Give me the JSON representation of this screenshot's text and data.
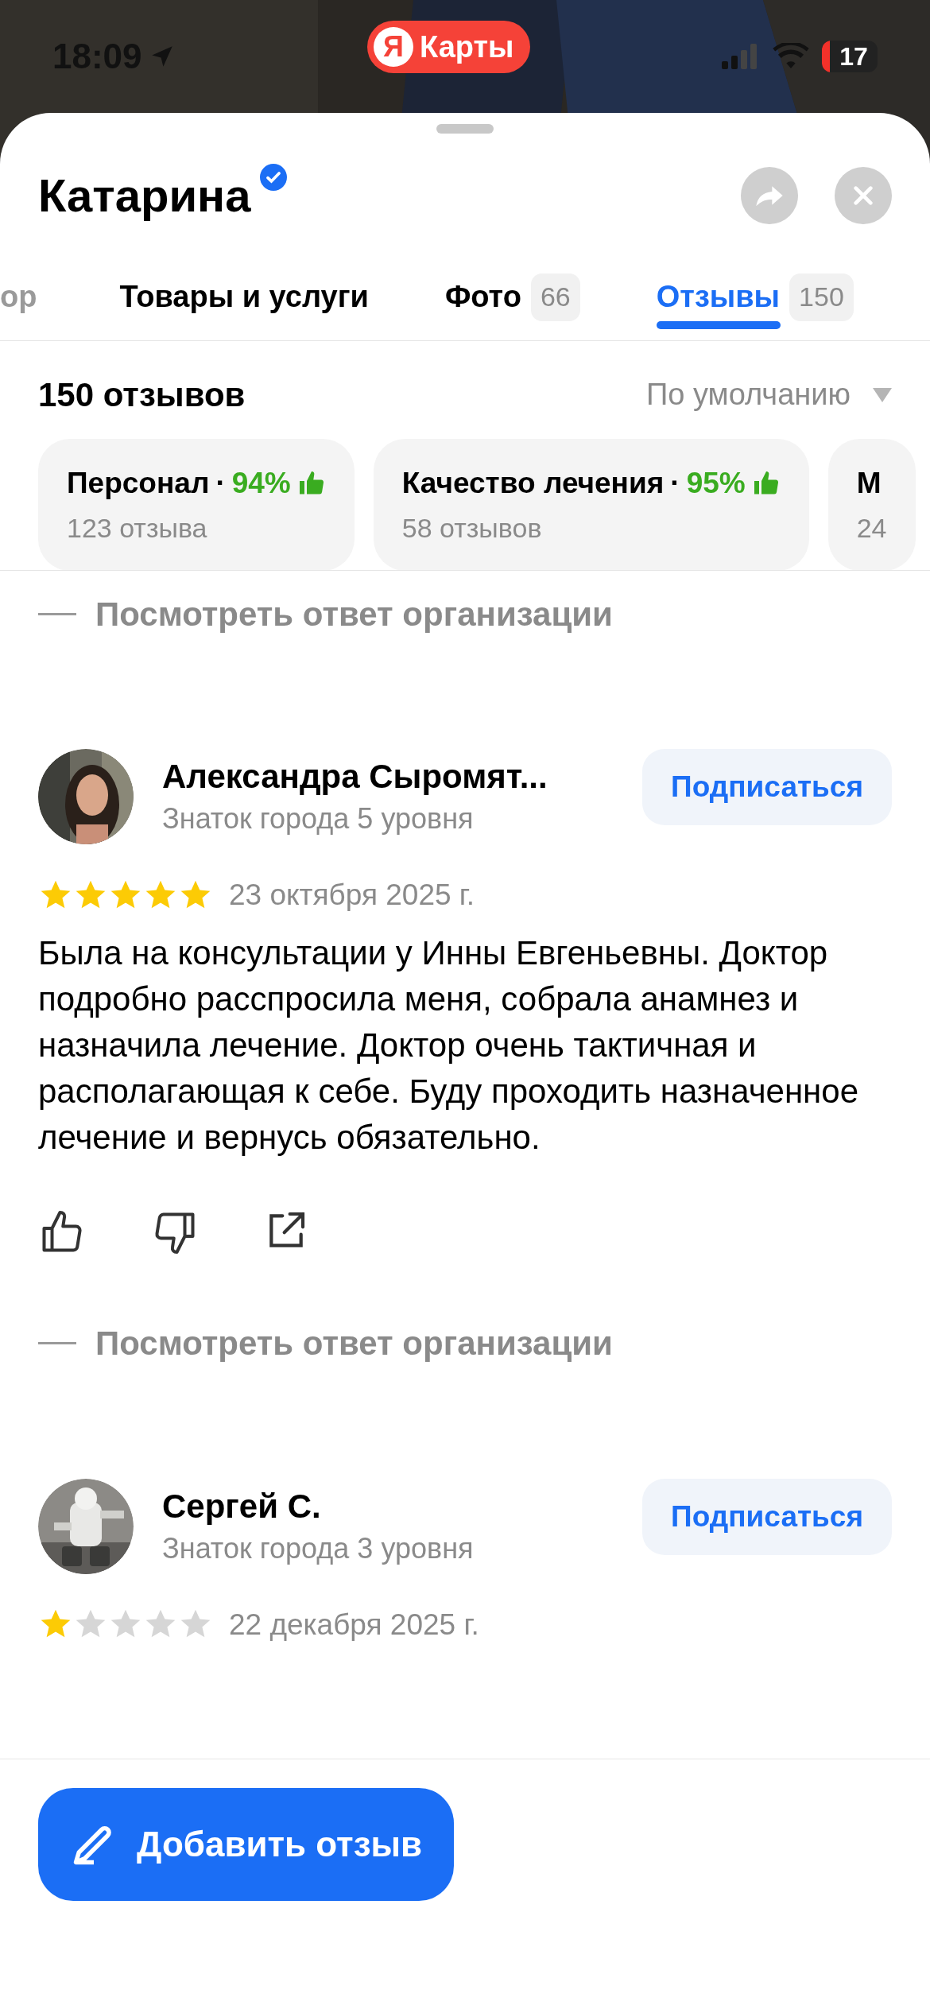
{
  "status_bar": {
    "time": "18:09",
    "app_badge": {
      "logo": "Я",
      "label": "Карты"
    },
    "battery": "17"
  },
  "header": {
    "title": "Катарина",
    "verified": true
  },
  "tabs": [
    {
      "label": "ор",
      "selected": false
    },
    {
      "label": "Товары и услуги",
      "selected": false
    },
    {
      "label": "Фото",
      "count": "66",
      "selected": false
    },
    {
      "label": "Отзывы",
      "count": "150",
      "selected": true
    }
  ],
  "summary": {
    "count_label": "150 отзывов",
    "sort": "По умолчанию"
  },
  "aspects": [
    {
      "name": "Персонал",
      "separator": "·",
      "percent": "94%",
      "count": "123 отзыва"
    },
    {
      "name": "Качество лечения",
      "separator": "·",
      "percent": "95%",
      "count": "58 отзывов"
    },
    {
      "name": "М",
      "count": "24"
    }
  ],
  "feed": [
    {
      "kind": "reply_link",
      "label": "Посмотреть ответ организации"
    },
    {
      "kind": "review",
      "author": "Александра Сыромят...",
      "level": "Знаток города 5 уровня",
      "subscribe": "Подписаться",
      "stars": 5,
      "date": "23 октября 2025 г.",
      "text": "Была на консультации у Инны Евгеньевны. Доктор подробно расспросила меня, собрала анамнез и назначила лечение. Доктор очень тактичная и располагающая к себе. Буду проходить назначенное лечение и вернусь обязательно.",
      "actions": true
    },
    {
      "kind": "reply_link",
      "label": "Посмотреть ответ организации"
    },
    {
      "kind": "review",
      "author": "Сергей С.",
      "level": "Знаток города 3 уровня",
      "subscribe": "Подписаться",
      "stars": 1,
      "date": "22 декабря 2025 г.",
      "actions": false
    }
  ],
  "add_review": {
    "label": "Добавить отзыв"
  }
}
